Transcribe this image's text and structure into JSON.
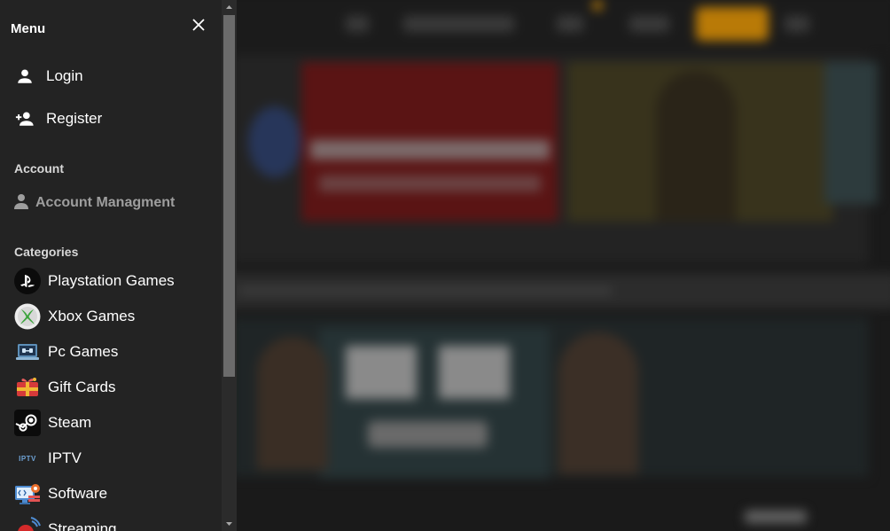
{
  "menu": {
    "title": "Menu",
    "login_label": "Login",
    "register_label": "Register",
    "account_section": "Account",
    "account_management_label": "Account Managment",
    "categories_section": "Categories",
    "categories": [
      {
        "label": "Playstation Games",
        "icon": "playstation-icon"
      },
      {
        "label": "Xbox Games",
        "icon": "xbox-icon"
      },
      {
        "label": "Pc Games",
        "icon": "pc-icon"
      },
      {
        "label": "Gift Cards",
        "icon": "gift-card-icon"
      },
      {
        "label": "Steam",
        "icon": "steam-icon"
      },
      {
        "label": "IPTV",
        "icon": "iptv-icon"
      },
      {
        "label": "Software",
        "icon": "software-icon"
      },
      {
        "label": "Streaming",
        "icon": "streaming-icon"
      }
    ],
    "iptv_icon_text": "IPTV"
  },
  "colors": {
    "menu_bg": "#232323",
    "page_bg": "#1a1a1a",
    "accent_orange": "#b97a07",
    "muted_text": "#9e9e9e"
  }
}
